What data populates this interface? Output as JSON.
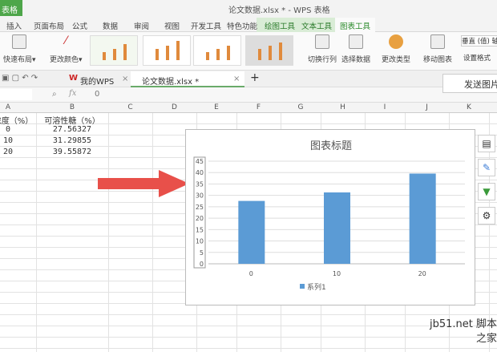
{
  "app": {
    "menu_label": "表格",
    "title": "论文数据.xlsx * - WPS 表格"
  },
  "tabs": [
    "插入",
    "页面布局",
    "公式",
    "数据",
    "审阅",
    "视图",
    "开发工具",
    "特色功能",
    "绘图工具",
    "文本工具",
    "图表工具"
  ],
  "ribbon": {
    "quick_layout": "快速布局",
    "change_color": "更改颜色",
    "switch_rowcol": "切换行列",
    "select_data": "选择数据",
    "change_type": "更改类型",
    "move_chart": "移动图表",
    "axis_select": "垂直 (值) 轴",
    "set_format": "设置格式"
  },
  "doctabs": {
    "my_wps": "我的WPS",
    "file": "论文数据.xlsx *",
    "send": "发送图片"
  },
  "formula": {
    "fx": "fx",
    "value": "0"
  },
  "columns": [
    "A",
    "B",
    "C",
    "D",
    "E",
    "F",
    "G",
    "H",
    "I",
    "J",
    "K"
  ],
  "table": {
    "headers": [
      "浓度（%）",
      "可溶性糖（%）"
    ],
    "rows": [
      [
        "0",
        "27.56327"
      ],
      [
        "10",
        "31.29855"
      ],
      [
        "20",
        "39.55872"
      ]
    ]
  },
  "chart_data": {
    "type": "bar",
    "title": "图表标题",
    "categories": [
      "0",
      "10",
      "20"
    ],
    "series": [
      {
        "name": "系列1",
        "values": [
          27.56327,
          31.29855,
          39.55872
        ],
        "color": "#5b9bd5"
      }
    ],
    "ylim": [
      0,
      45
    ],
    "yticks": [
      "0",
      "5",
      "10",
      "15",
      "20",
      "25",
      "30",
      "35",
      "40",
      "45"
    ],
    "legend": "bottom",
    "grid": true
  },
  "watermark": "jb51.net 脚本之家"
}
